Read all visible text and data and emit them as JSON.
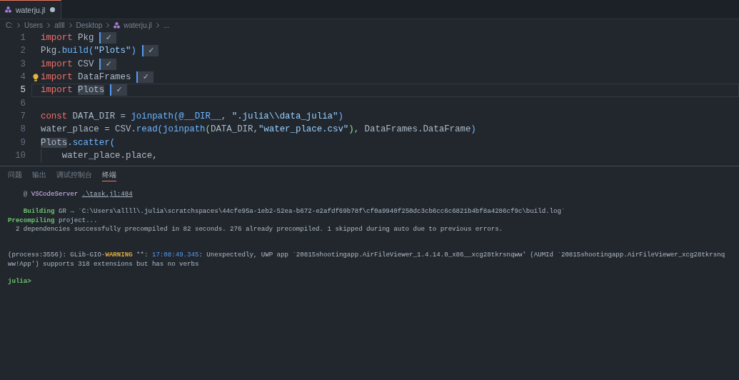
{
  "tabs": [
    {
      "label": "waterju.jl",
      "selected": true,
      "modified": true
    }
  ],
  "breadcrumb": [
    {
      "label": "C:",
      "kind": "folder"
    },
    {
      "label": "Users",
      "kind": "folder"
    },
    {
      "label": "allll",
      "kind": "folder"
    },
    {
      "label": "Desktop",
      "kind": "folder"
    },
    {
      "label": "waterju.jl",
      "kind": "file"
    },
    {
      "label": "...",
      "kind": "symbol"
    }
  ],
  "code_lines": [
    {
      "number": "1",
      "current": false,
      "lightbulb": false,
      "tokens": [
        {
          "text": "import",
          "kind": "keyword",
          "highlighted": false
        },
        {
          "text": " Pkg",
          "kind": "plain",
          "highlighted": false
        }
      ],
      "result": "✓"
    },
    {
      "number": "2",
      "current": false,
      "lightbulb": false,
      "tokens": [
        {
          "text": "Pkg.",
          "kind": "plain",
          "highlighted": false
        },
        {
          "text": "build",
          "kind": "function",
          "highlighted": false
        },
        {
          "text": "(",
          "kind": "bracket1",
          "highlighted": false
        },
        {
          "text": "\"Plots\"",
          "kind": "string",
          "highlighted": false
        },
        {
          "text": ")",
          "kind": "bracket1",
          "highlighted": false
        }
      ],
      "result": "✓"
    },
    {
      "number": "3",
      "current": false,
      "lightbulb": false,
      "tokens": [
        {
          "text": "import",
          "kind": "keyword",
          "highlighted": false
        },
        {
          "text": " CSV",
          "kind": "plain",
          "highlighted": false
        }
      ],
      "result": "✓"
    },
    {
      "number": "4",
      "current": false,
      "lightbulb": true,
      "tokens": [
        {
          "text": "import",
          "kind": "keyword",
          "highlighted": false
        },
        {
          "text": " DataFrames",
          "kind": "plain",
          "highlighted": false
        }
      ],
      "result": "✓"
    },
    {
      "number": "5",
      "current": true,
      "lightbulb": false,
      "tokens": [
        {
          "text": "import ",
          "kind": "keyword",
          "highlighted": false
        },
        {
          "text": "Plots",
          "kind": "plain",
          "highlighted": true
        }
      ],
      "result": "✓"
    },
    {
      "number": "6",
      "current": false,
      "lightbulb": false
    },
    {
      "number": "7",
      "current": false,
      "lightbulb": false,
      "tokens": [
        {
          "text": "const",
          "kind": "keyword",
          "highlighted": false
        },
        {
          "text": " DATA_DIR = ",
          "kind": "plain",
          "highlighted": false
        },
        {
          "text": "joinpath",
          "kind": "function",
          "highlighted": false
        },
        {
          "text": "(",
          "kind": "bracket1",
          "highlighted": false
        },
        {
          "text": "@__DIR__",
          "kind": "constant",
          "highlighted": false
        },
        {
          "text": ", ",
          "kind": "plain",
          "highlighted": false
        },
        {
          "text": "\".julia\\\\data_julia\"",
          "kind": "string",
          "highlighted": false
        },
        {
          "text": ")",
          "kind": "bracket1",
          "highlighted": false
        }
      ]
    },
    {
      "number": "8",
      "current": false,
      "lightbulb": false,
      "tokens": [
        {
          "text": "water_place = CSV.",
          "kind": "plain",
          "highlighted": false
        },
        {
          "text": "read",
          "kind": "function",
          "highlighted": false
        },
        {
          "text": "(",
          "kind": "bracket1",
          "highlighted": false
        },
        {
          "text": "joinpath",
          "kind": "function",
          "highlighted": false
        },
        {
          "text": "(",
          "kind": "bracket2",
          "highlighted": false
        },
        {
          "text": "DATA_DIR,",
          "kind": "plain",
          "highlighted": false
        },
        {
          "text": "\"water_place.csv\"",
          "kind": "string",
          "highlighted": false
        },
        {
          "text": ")",
          "kind": "bracket2",
          "highlighted": false
        },
        {
          "text": ", DataFrames.DataFrame",
          "kind": "plain",
          "highlighted": false
        },
        {
          "text": ")",
          "kind": "bracket1",
          "highlighted": false
        }
      ]
    },
    {
      "number": "9",
      "current": false,
      "lightbulb": false,
      "tokens": [
        {
          "text": "Plots",
          "kind": "plain",
          "highlighted": true
        },
        {
          "text": ".",
          "kind": "plain",
          "highlighted": false
        },
        {
          "text": "scatter",
          "kind": "function",
          "highlighted": false
        },
        {
          "text": "(",
          "kind": "bracket1",
          "highlighted": false
        }
      ]
    },
    {
      "number": "10",
      "current": false,
      "lightbulb": false,
      "tokens": [
        {
          "text": "    water_place.place,",
          "kind": "plain",
          "highlighted": false
        }
      ]
    }
  ],
  "panel_tabs": [
    {
      "label": "问题",
      "selected": false
    },
    {
      "label": "输出",
      "selected": false
    },
    {
      "label": "调试控制台",
      "selected": false
    },
    {
      "label": "终端",
      "selected": true
    }
  ],
  "terminal": {
    "lines": [
      {
        "kind": "text",
        "segments": [
          {
            "text": "    @ ",
            "kind": "dim"
          },
          {
            "text": "VSCodeServer ",
            "kind": "name"
          },
          {
            "text": ".\\task.jl:484",
            "kind": "link"
          }
        ]
      },
      {
        "kind": "blank"
      },
      {
        "kind": "text",
        "segments": [
          {
            "text": "    Building",
            "kind": "ok"
          },
          {
            "text": " GR → `C:\\Users\\allll\\.julia\\scratchspaces\\44cfe95a-1eb2-52ea-b672-e2afdf69b78f\\cf0a9940f250dc3cb6cc6c6821b4bf8a4286cf9c\\build.log`",
            "kind": "plain"
          }
        ]
      },
      {
        "kind": "text",
        "segments": [
          {
            "text": "Precompiling",
            "kind": "ok"
          },
          {
            "text": " project...",
            "kind": "plain"
          }
        ]
      },
      {
        "kind": "text",
        "segments": [
          {
            "text": "  2 dependencies successfully precompiled in 82 seconds. 276 already precompiled. 1 skipped during auto due to previous errors.",
            "kind": "plain"
          }
        ]
      },
      {
        "kind": "blank"
      },
      {
        "kind": "blank"
      },
      {
        "kind": "text",
        "segments": [
          {
            "text": "(process:3556): GLib-GIO-",
            "kind": "plain"
          },
          {
            "text": "WARNING",
            "kind": "warn"
          },
          {
            "text": " **: ",
            "kind": "plain"
          },
          {
            "text": "17:08:49.345",
            "kind": "time"
          },
          {
            "text": ": Unexpectedly, UWP app `20815shootingapp.AirFileViewer_1.4.14.0_x86__xcg28tkrsnqww' (AUMId `20815shootingapp.AirFileViewer_xcg28tkrsnq",
            "kind": "plain"
          }
        ]
      },
      {
        "kind": "text",
        "segments": [
          {
            "text": "ww!App') supports 318 extensions but has no verbs",
            "kind": "plain"
          }
        ]
      },
      {
        "kind": "blank"
      },
      {
        "kind": "text",
        "segments": [
          {
            "text": "julia>",
            "kind": "ok"
          }
        ]
      }
    ]
  }
}
